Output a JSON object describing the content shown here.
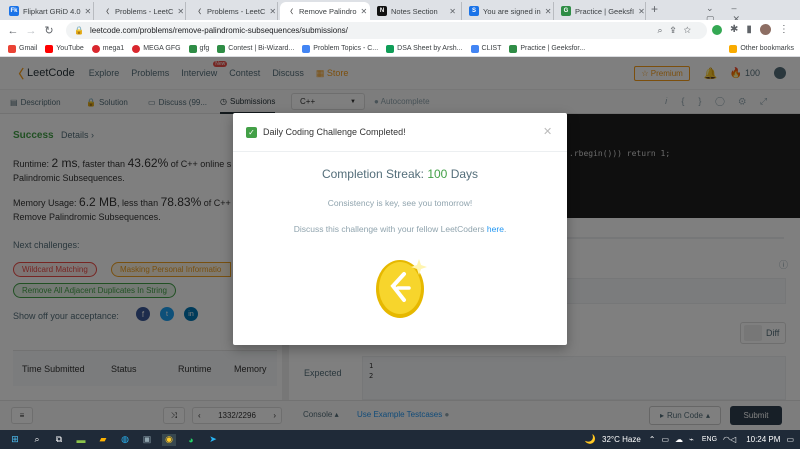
{
  "browser": {
    "tabs": [
      {
        "title": "Flipkart GRiD 4.0",
        "icon": "flipkart-icon",
        "color": "#1a73e8"
      },
      {
        "title": "Problems - LeetC",
        "icon": "leetcode-icon",
        "color": "#f89f1b"
      },
      {
        "title": "Problems - LeetC",
        "icon": "leetcode-icon",
        "color": "#f89f1b"
      },
      {
        "title": "Remove Palindro",
        "icon": "leetcode-icon",
        "color": "#f89f1b",
        "active": true
      },
      {
        "title": "Notes Section",
        "icon": "notes-icon",
        "color": "#111111"
      },
      {
        "title": "You are signed in",
        "icon": "signed-in-icon",
        "color": "#1a73e8"
      },
      {
        "title": "Practice | GeeksfI",
        "icon": "gfg-icon",
        "color": "#2f8d46"
      }
    ],
    "new_tab": "+",
    "url": "leetcode.com/problems/remove-palindromic-subsequences/submissions/",
    "bookmarks": [
      {
        "label": "Gmail",
        "color": "#ea4335"
      },
      {
        "label": "YouTube",
        "color": "#ff0000"
      },
      {
        "label": "mega1",
        "color": "#d9272e"
      },
      {
        "label": "MEGA GFG",
        "color": "#d9272e"
      },
      {
        "label": "gfg",
        "color": "#2f8d46"
      },
      {
        "label": "Contest | Bi-Wizard...",
        "color": "#2f8d46"
      },
      {
        "label": "Problem Topics - C...",
        "color": "#4285f4"
      },
      {
        "label": "DSA Sheet by Arsh...",
        "color": "#0f9d58"
      },
      {
        "label": "CLIST",
        "color": "#4285f4"
      },
      {
        "label": "Practice | Geeksfor...",
        "color": "#2f8d46"
      }
    ],
    "other_bookmarks": "Other bookmarks"
  },
  "leetcode": {
    "logo": "LeetCode",
    "nav": [
      "Explore",
      "Problems",
      "Interview",
      "Contest",
      "Discuss",
      "Store"
    ],
    "new_badge": "New",
    "premium": "Premium",
    "coins": "100",
    "subtabs": [
      "Description",
      "Solution",
      "Discuss (99...",
      "Submissions"
    ],
    "language": "C++",
    "autocomplete": "Autocomplete",
    "code_snippet": ".rbegin())) return 1;"
  },
  "result": {
    "status": "Success",
    "details": "Details",
    "runtime_prefix": "Runtime: ",
    "runtime_value": "2 ms",
    "runtime_mid": ", faster than ",
    "runtime_pct": "43.62%",
    "runtime_suffix": " of C++ online s",
    "runtime_line2": "Palindromic Subsequences.",
    "memory_prefix": "Memory Usage: ",
    "memory_value": "6.2 MB",
    "memory_mid": ", less than ",
    "memory_pct": "78.83%",
    "memory_suffix": " of C++",
    "memory_line2": "Remove Palindromic Subsequences.",
    "next_label": "Next challenges:",
    "challenges": [
      {
        "label": "Wildcard Matching",
        "color": "#ec4c47"
      },
      {
        "label": "Masking Personal Informatio",
        "color": "#f0a020"
      },
      {
        "label": "Remove All Adjacent Duplicates In String",
        "color": "#43a047"
      }
    ],
    "share_label": "Show off your acceptance:",
    "table_headers": [
      "Time Submitted",
      "Status",
      "Runtime",
      "Memory"
    ]
  },
  "console": {
    "expected_label": "Expected",
    "expected_values": [
      "1",
      "2"
    ],
    "diff": "Diff"
  },
  "bottombar": {
    "pager": "1332/2296",
    "console": "Console",
    "testcases": "Use Example Testcases",
    "run": "Run Code",
    "submit": "Submit"
  },
  "modal": {
    "title": "Daily Coding Challenge Completed!",
    "streak_prefix": "Completion Streak: ",
    "streak_value": "100",
    "streak_suffix": " Days",
    "line1": "Consistency is key, see you tomorrow!",
    "line2_prefix": "Discuss this challenge with your fellow LeetCoders ",
    "line2_link": "here",
    "line2_suffix": "."
  },
  "taskbar": {
    "weather": "32°C  Haze",
    "lang": "ENG",
    "time": "10:24 PM"
  }
}
